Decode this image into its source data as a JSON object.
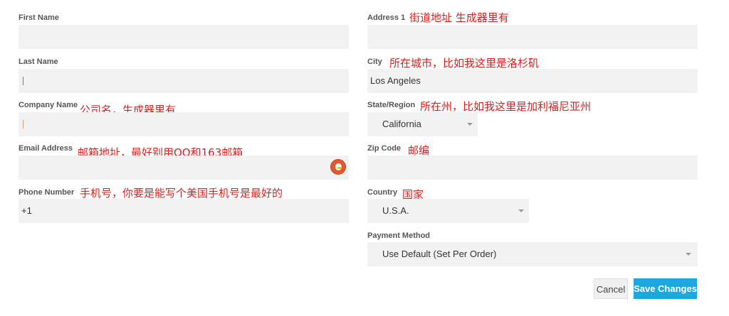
{
  "form": {
    "left": {
      "first_name": {
        "label": "First Name",
        "value": ""
      },
      "last_name": {
        "label": "Last Name",
        "value": ""
      },
      "company_name": {
        "label": "Company Name",
        "value": "",
        "note": "公司名，生成器里有"
      },
      "email_address": {
        "label": "Email Address",
        "value": "",
        "note": "邮箱地址，最好别用QQ和163邮箱"
      },
      "phone_number": {
        "label": "Phone Number",
        "value": "+1",
        "note": "手机号，你要是能写个美国手机号是最好的"
      }
    },
    "right": {
      "address1": {
        "label": "Address 1",
        "value": "",
        "note": "街道地址  生成器里有"
      },
      "city": {
        "label": "City",
        "value": "Los Angeles",
        "note": "所在城市，比如我这里是洛杉矶"
      },
      "state": {
        "label": "State/Region",
        "value": "California",
        "note": "所在州，比如我这里是加利福尼亚州"
      },
      "zip": {
        "label": "Zip Code",
        "value": "",
        "note": "邮编"
      },
      "country": {
        "label": "Country",
        "value": "U.S.A.",
        "note": "国家"
      },
      "payment": {
        "label": "Payment Method",
        "value": "Use Default (Set Per Order)"
      }
    }
  },
  "buttons": {
    "cancel": "Cancel",
    "save": "Save Changes"
  },
  "icons": {
    "email_autofill": "duckduckgo-icon",
    "select_caret": "caret-down-icon"
  },
  "colors": {
    "note_red": "#d9201f",
    "save_blue": "#1aa8de",
    "field_bg": "#f2f2f2"
  }
}
